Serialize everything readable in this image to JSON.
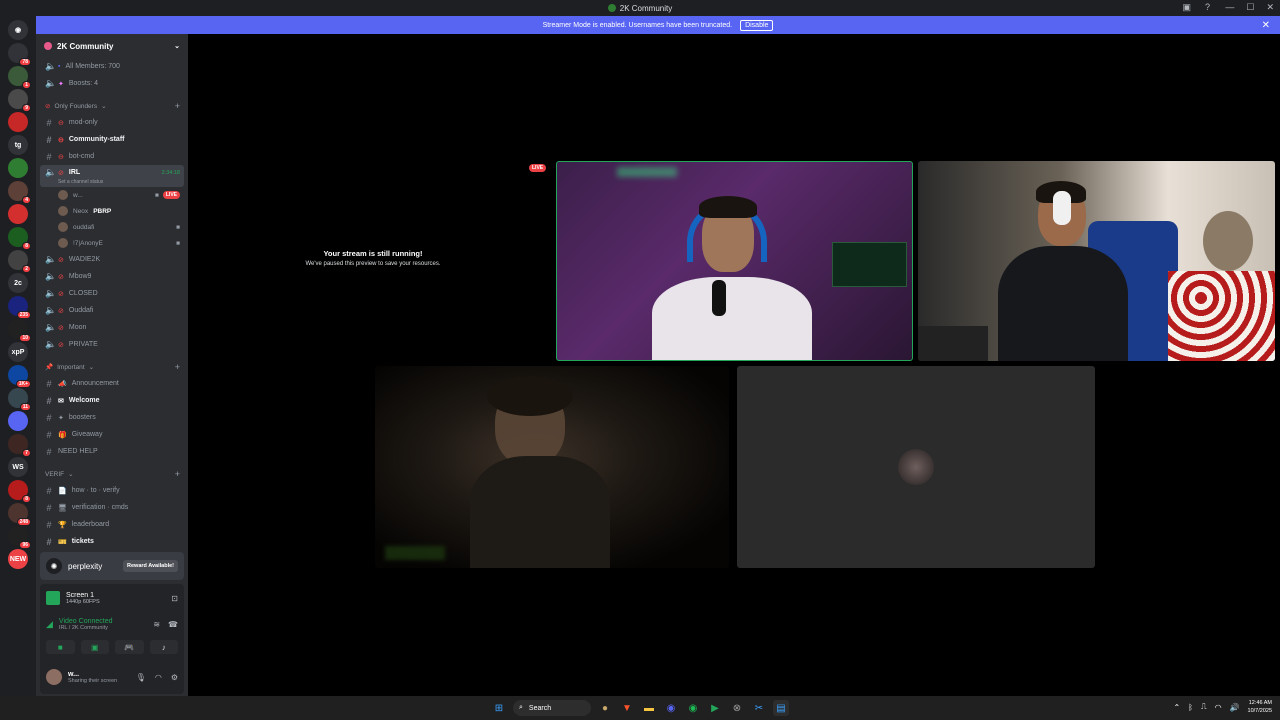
{
  "window": {
    "title": "2K Community"
  },
  "banner": {
    "text": "Streamer Mode is enabled. Usernames have been truncated.",
    "button": "Disable"
  },
  "guilds": [
    {
      "label": "",
      "badge": "78",
      "color": "#313338"
    },
    {
      "label": "",
      "badge": "1",
      "color": "#3a5a3a"
    },
    {
      "label": "",
      "badge": "9",
      "color": "#4a4a4a"
    },
    {
      "label": "",
      "badge": "",
      "color": "#c62828"
    },
    {
      "label": "tg",
      "badge": "",
      "color": "#313338"
    },
    {
      "label": "",
      "badge": "",
      "color": "#2e7d32"
    },
    {
      "label": "",
      "badge": "4",
      "color": "#5d4037"
    },
    {
      "label": "",
      "badge": "",
      "color": "#d32f2f"
    },
    {
      "label": "",
      "badge": "8",
      "color": "#1b5e20"
    },
    {
      "label": "",
      "badge": "2",
      "color": "#424242"
    },
    {
      "label": "2c",
      "badge": "",
      "color": "#313338"
    },
    {
      "label": "",
      "badge": "235",
      "color": "#1a237e"
    },
    {
      "label": "",
      "badge": "10",
      "color": "#212121"
    },
    {
      "label": "xpP",
      "badge": "",
      "color": "#313338"
    },
    {
      "label": "",
      "badge": "1K+",
      "color": "#0d47a1"
    },
    {
      "label": "",
      "badge": "11",
      "color": "#37474f"
    },
    {
      "label": "",
      "badge": "",
      "color": "#5865f2"
    },
    {
      "label": "",
      "badge": "7",
      "color": "#3e2723"
    },
    {
      "label": "WS",
      "badge": "",
      "color": "#313338"
    },
    {
      "label": "",
      "badge": "8",
      "color": "#b71c1c"
    },
    {
      "label": "",
      "badge": "248",
      "color": "#4e342e"
    },
    {
      "label": "",
      "badge": "96",
      "color": "#212121"
    },
    {
      "label": "NEW",
      "badge": "",
      "color": "#ed4245"
    }
  ],
  "server": {
    "name": "2K Community"
  },
  "channels_top": [
    {
      "name": "All Members: 700",
      "prefix": "!"
    },
    {
      "name": "Boosts: 4",
      "prefix": "!"
    }
  ],
  "categories": {
    "founders": "Only Founders",
    "important": "Important",
    "verif": "VERIF"
  },
  "founders_channels": [
    {
      "name": "mod-only",
      "bold": false
    },
    {
      "name": "Community-staff",
      "bold": true
    },
    {
      "name": "bot-cmd",
      "bold": false
    }
  ],
  "irl": {
    "name": "IRL",
    "timer": "2:34:18",
    "status": "Set a channel status"
  },
  "voice_users": [
    {
      "name": "w...",
      "live": "LIVE"
    },
    {
      "name": "Neox",
      "tag": "PBRP"
    },
    {
      "name": "ouddafi"
    },
    {
      "name": "!7|AnonyE"
    }
  ],
  "voice_channels": [
    "WADIE2K",
    "Mbow9",
    "CLOSED",
    "Ouddafi",
    "Moon",
    "PRIVATE"
  ],
  "important_channels": [
    {
      "name": "Announcement",
      "bold": false
    },
    {
      "name": "Welcome",
      "bold": true
    },
    {
      "name": "boosters",
      "bold": false
    },
    {
      "name": "Giveaway",
      "bold": false
    },
    {
      "name": "NEED HELP",
      "bold": false
    }
  ],
  "verif_channels": [
    {
      "name": "how · to · verify",
      "bold": false
    },
    {
      "name": "verification · cmds",
      "bold": false
    },
    {
      "name": "leaderboard",
      "bold": false
    },
    {
      "name": "tickets",
      "bold": true
    }
  ],
  "promo": {
    "brand": "perplexity",
    "button": "Reward Available!"
  },
  "screen": {
    "title": "Screen 1",
    "sub": "1440p 60FPS"
  },
  "connection": {
    "status": "Video Connected",
    "location": "IRL / 2K Community"
  },
  "user": {
    "name": "w...",
    "status": "Sharing their screen"
  },
  "stream": {
    "live": "LIVE",
    "paused_title": "Your stream is still running!",
    "paused_sub": "We've paused this preview to save your resources."
  },
  "taskbar": {
    "search": "Search",
    "time": "12:46 AM",
    "date": "10/7/2025"
  }
}
